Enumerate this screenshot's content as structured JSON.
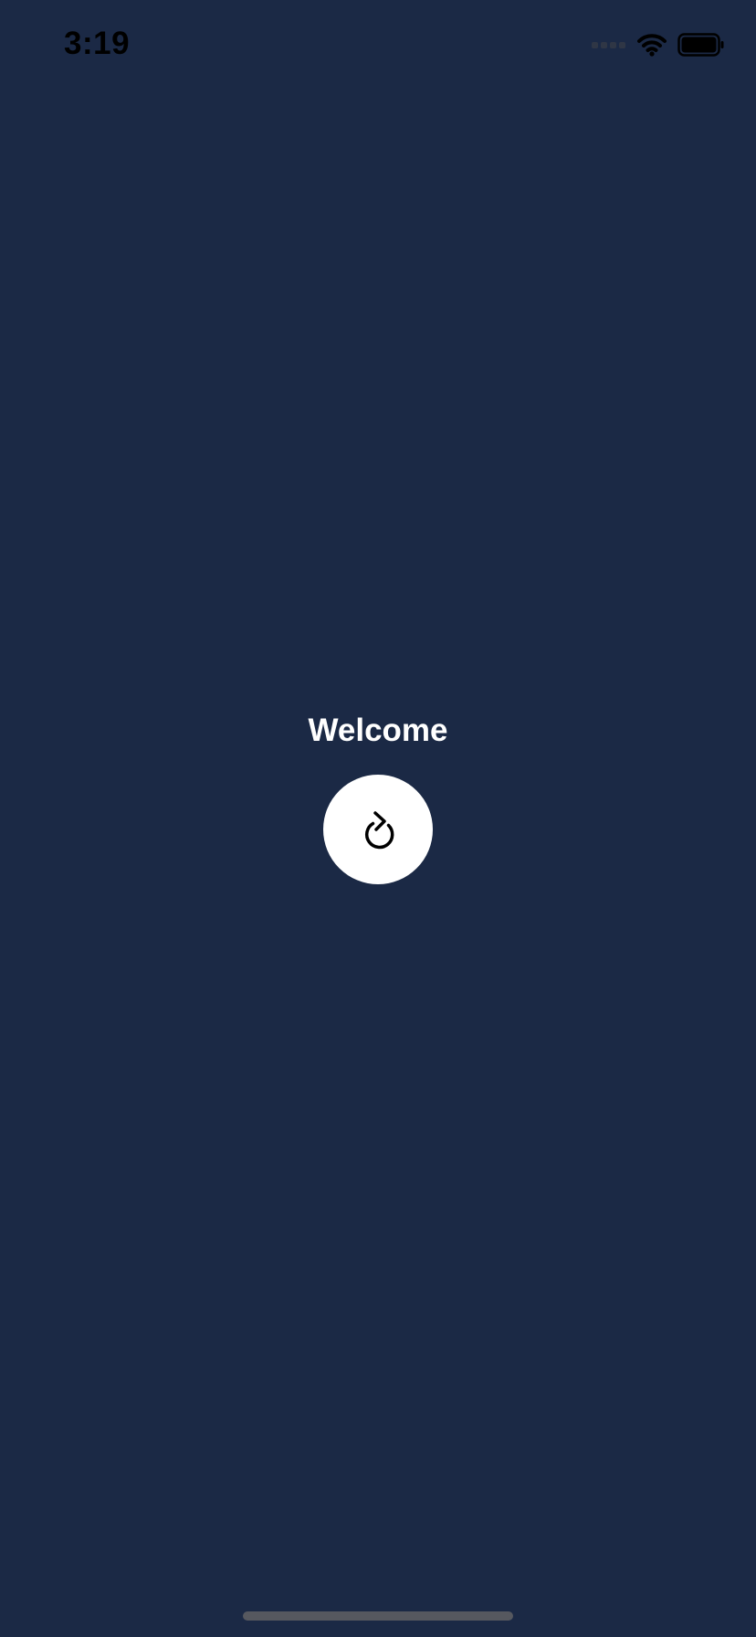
{
  "status_bar": {
    "time": "3:19",
    "signal_icon": "cellular-signal-icon",
    "wifi_icon": "wifi-icon",
    "battery_icon": "battery-icon",
    "battery_level": 1.0
  },
  "main": {
    "title": "Welcome",
    "refresh_button_icon": "refresh-icon"
  },
  "colors": {
    "background": "#1b2945",
    "title_text": "#ffffff",
    "button_background": "#ffffff",
    "icon": "#000000",
    "home_indicator": "#56585f"
  }
}
